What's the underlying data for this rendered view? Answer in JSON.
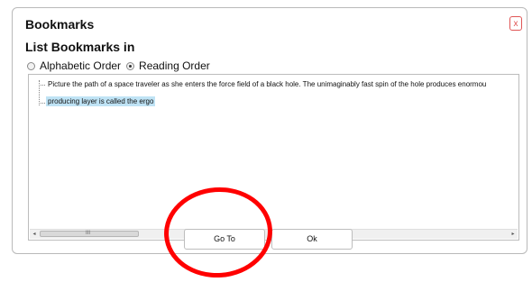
{
  "dialog": {
    "title": "Bookmarks",
    "close_label": "x",
    "list_label": "List Bookmarks in",
    "order_options": [
      {
        "label": "Alphabetic Order",
        "selected": false
      },
      {
        "label": "Reading Order",
        "selected": true
      }
    ],
    "bookmarks": [
      {
        "text": "Picture the path of a space traveler as she enters the force field of a black hole. The unimaginably fast spin of the hole produces enormou",
        "selected": false
      },
      {
        "text": "producing layer is called the ergo",
        "selected": true
      }
    ],
    "scroll_grip": "III",
    "scroll_left_arrow": "◂",
    "scroll_right_arrow": "▸",
    "goto_label": "Go To",
    "ok_label": "Ok"
  },
  "colors": {
    "selection": "#bfe3f5",
    "annotation_circle": "#ff0000",
    "close_accent": "#e05555"
  },
  "icons": [
    "close-icon",
    "radio-icon",
    "scroll-arrow-left-icon",
    "scroll-arrow-right-icon"
  ]
}
